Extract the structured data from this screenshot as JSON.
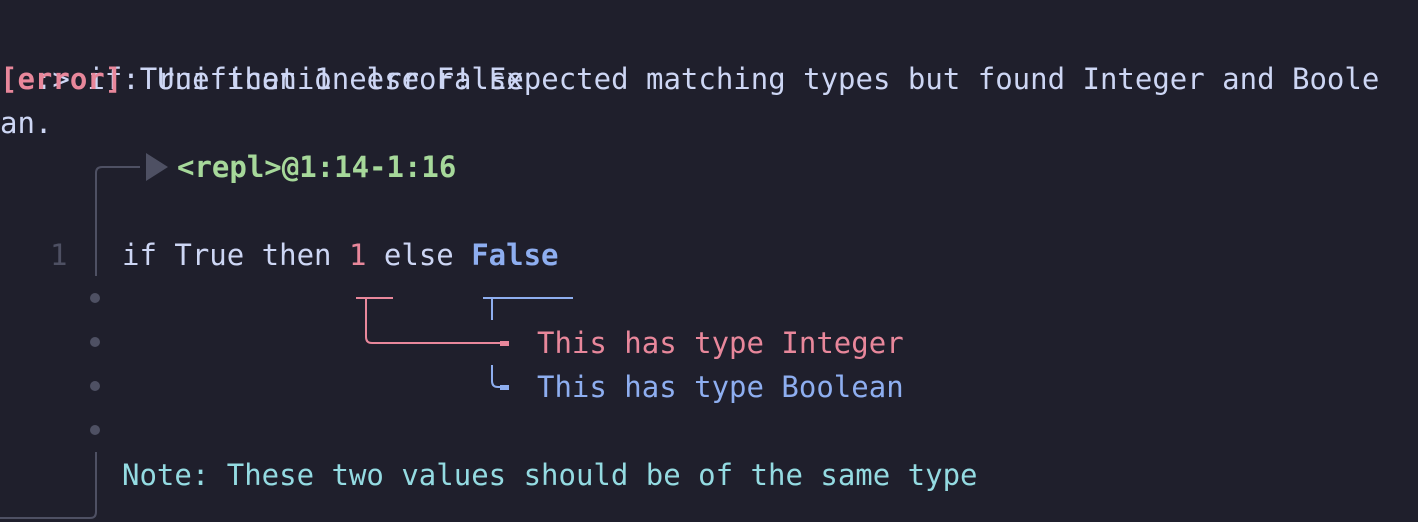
{
  "terminal": {
    "prompt": ":>",
    "input": "if True then 1 else False",
    "error": {
      "tag": "[error]",
      "message_line1": ": Unification error! Expected matching types but found Integer and Boole",
      "message_line2": "an."
    },
    "report": {
      "location": "<repl>@1:14-1:16",
      "line_number": "1",
      "code": {
        "before": "if True then ",
        "span1": "1",
        "middle": " else ",
        "span2": "False"
      },
      "labels": [
        {
          "text": "This has type Integer",
          "color": "#e8879b"
        },
        {
          "text": "This has type Boolean",
          "color": "#8eaef0"
        }
      ],
      "note": "Note: These two values should be of the same type"
    }
  },
  "colors": {
    "background": "#1f1f2c",
    "text": "#cdd6f4",
    "error": "#e8879b",
    "secondary": "#8eaef0",
    "location": "#a6d89a",
    "note": "#94dbe2",
    "gutter": "#4e5063"
  }
}
